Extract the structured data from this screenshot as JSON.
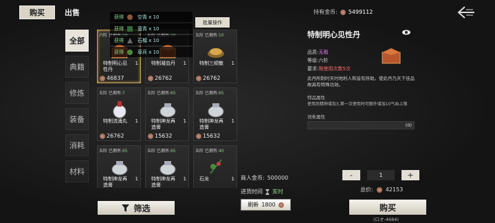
{
  "tabs": {
    "buy": "购买",
    "sell": "出售"
  },
  "categories": [
    "全部",
    "典籍",
    "修炼",
    "装备",
    "消耗",
    "材料"
  ],
  "items": [
    {
      "tag": "六阶",
      "owned": "10",
      "owned_label": "已拥有:",
      "name": "特制明心见性丹",
      "count": "1",
      "price": "46837",
      "selected": true,
      "icon": "pill-box-icon"
    },
    {
      "tag": "五阶",
      "owned": "10",
      "owned_label": "已拥有:",
      "name": "特制凝血丹",
      "count": "1",
      "price": "26762",
      "selected": false,
      "icon": "pill-box-icon"
    },
    {
      "tag": "五阶",
      "owned": "10",
      "owned_label": "已拥有:",
      "name": "特制三顺散",
      "count": "1",
      "price": "26762",
      "selected": false,
      "icon": "powder-icon"
    },
    {
      "tag": "五阶",
      "owned": "7",
      "owned_label": "已拥有:",
      "name": "特制流涌丸",
      "count": "1",
      "price": "26762",
      "selected": false,
      "icon": "bottle-icon"
    },
    {
      "tag": "五阶",
      "owned": "65",
      "owned_label": "已拥有:",
      "name": "特制神龙再造膏",
      "count": "1",
      "price": "15632",
      "selected": false,
      "icon": "pot-icon"
    },
    {
      "tag": "五阶",
      "owned": "65",
      "owned_label": "已拥有:",
      "name": "特制神龙再造膏",
      "count": "1",
      "price": "15632",
      "selected": false,
      "icon": "pot-icon"
    },
    {
      "tag": "五阶",
      "owned": "65",
      "owned_label": "已拥有:",
      "name": "特制神龙再造膏",
      "count": "1",
      "price": "",
      "selected": false,
      "icon": "pot-icon"
    },
    {
      "tag": "五阶",
      "owned": "65",
      "owned_label": "已拥有:",
      "name": "特制神龙再造膏",
      "count": "1",
      "price": "",
      "selected": false,
      "icon": "pot-icon"
    },
    {
      "tag": "五阶",
      "owned": "40",
      "owned_label": "已拥有:",
      "name": "石龙",
      "count": "1",
      "price": "",
      "selected": false,
      "icon": "herb-icon"
    }
  ],
  "obtained": {
    "label": "获得",
    "rows": [
      "空青 x 10",
      "萤青 x 10",
      "石榴 x 10",
      "草兵 x 10"
    ],
    "batch": "批量操作"
  },
  "merchant": {
    "gold_label": "商人金币:",
    "gold": "500000",
    "restock_label": "进货时间",
    "restock": "亥时"
  },
  "refresh": {
    "label": "刷新",
    "cost": "1800"
  },
  "filter": "筛选",
  "right": {
    "gold_label": "持有金币:",
    "gold": "5499112",
    "title": "特制明心见性丹",
    "quality_label": "品质:",
    "quality": "无暇",
    "grade_label": "等级:",
    "grade": "六阶",
    "req_label": "要求:",
    "req": "限使用次数5次",
    "desc": "此丹所制时天时地利人和皆有所助。使此丹乃天下佳品故具有特殊功效。",
    "attr_title": "特品属性",
    "attr_body": "使用后精神增加3,第一次使用时可额外增加10气血上限",
    "entry_title": "词条属性",
    "entry_value": "(0)",
    "qty": "1",
    "minus": "-",
    "plus": "+",
    "total_label": "总价:",
    "total": "42153",
    "buy": "购买",
    "coord": "(ロオ-4684)"
  }
}
